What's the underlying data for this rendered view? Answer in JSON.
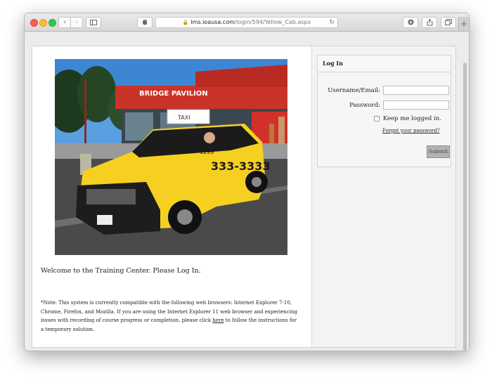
{
  "browser": {
    "url_host": "lms.ioausa.com",
    "url_path": "/login/594/Yellow_Cab.aspx",
    "new_tab": "+"
  },
  "left": {
    "photo": {
      "sign_text": "BRIDGE PAVILION",
      "roof_sign": "TAXI",
      "phone": "333-3333",
      "cab_number": "1299"
    },
    "welcome": "Welcome to the Training Center. Please Log In.",
    "note_before_link": "*Note: This system is currently compatible with the following web browsers: Internet Explorer 7-10, Chrome, Firefox, and Mozilla. If you are using the Internet Explorer 11 web browser and experiencing issues with recording of course progress or completion, please click ",
    "note_link": "here",
    "note_after_link": " to follow the instructions for a temporary solution."
  },
  "login": {
    "title": "Log In",
    "username_label": "Username/Email:",
    "username_value": "",
    "password_label": "Password:",
    "password_value": "",
    "keep_label": "Keep me logged in.",
    "forgot": "Forgot your password?",
    "submit": "Submit"
  },
  "colors": {
    "cab_yellow": "#f5d021",
    "pavilion_red": "#cc2f25",
    "submit_gray": "#b3b3b3"
  }
}
